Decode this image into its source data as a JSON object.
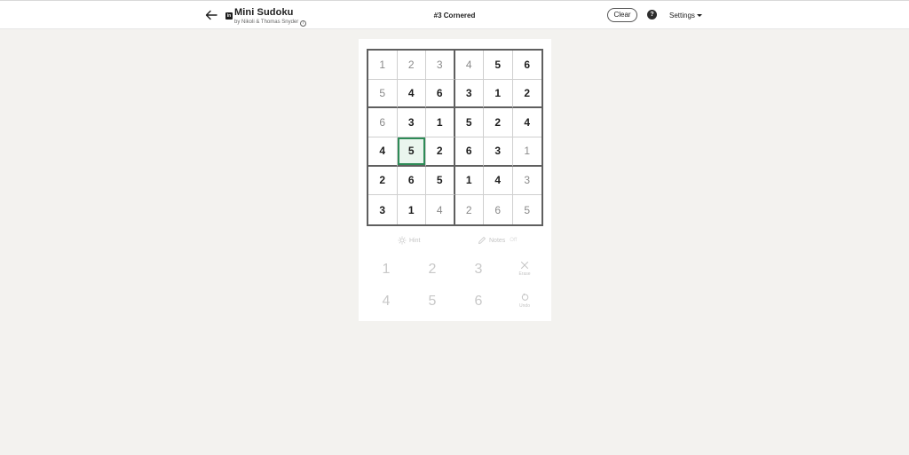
{
  "header": {
    "app_title": "Mini Sudoku",
    "byline": "by Nikoli & Thomas Snyder",
    "puzzle_name": "#3 Cornered",
    "clear_label": "Clear",
    "help_label": "?",
    "settings_label": "Settings"
  },
  "icons": {
    "back": "arrow-left-icon",
    "logo": "linkedin-icon",
    "info": "info-icon",
    "help": "question-circle-icon",
    "settings_caret": "caret-down-icon",
    "hint": "lightbulb-icon",
    "notes": "pencil-icon",
    "erase": "x-icon",
    "undo": "undo-icon"
  },
  "colors": {
    "background": "#f3f2ef",
    "selected_border": "#2e8b57",
    "selected_fill": "#eaf5ee",
    "given_digit": "#1d1d1d",
    "filled_digit": "#8a8a8a"
  },
  "board": {
    "rows": [
      [
        "1",
        "2",
        "3",
        "4",
        "5",
        "6"
      ],
      [
        "5",
        "4",
        "6",
        "3",
        "1",
        "2"
      ],
      [
        "6",
        "3",
        "1",
        "5",
        "2",
        "4"
      ],
      [
        "4",
        "5",
        "2",
        "6",
        "3",
        "1"
      ],
      [
        "2",
        "6",
        "5",
        "1",
        "4",
        "3"
      ],
      [
        "3",
        "1",
        "4",
        "2",
        "6",
        "5"
      ]
    ],
    "given": [
      [
        false,
        false,
        false,
        false,
        true,
        true
      ],
      [
        false,
        true,
        true,
        true,
        true,
        true
      ],
      [
        false,
        true,
        true,
        true,
        true,
        true
      ],
      [
        true,
        true,
        true,
        true,
        true,
        false
      ],
      [
        true,
        true,
        true,
        true,
        true,
        false
      ],
      [
        true,
        true,
        false,
        false,
        false,
        false
      ]
    ],
    "selected": {
      "row": 3,
      "col": 1
    }
  },
  "tools": {
    "hint_label": "Hint",
    "notes_label": "Notes",
    "notes_state": "Off"
  },
  "keypad": {
    "digits": [
      "1",
      "2",
      "3",
      "4",
      "5",
      "6"
    ],
    "erase_label": "Erase",
    "undo_label": "Undo"
  }
}
